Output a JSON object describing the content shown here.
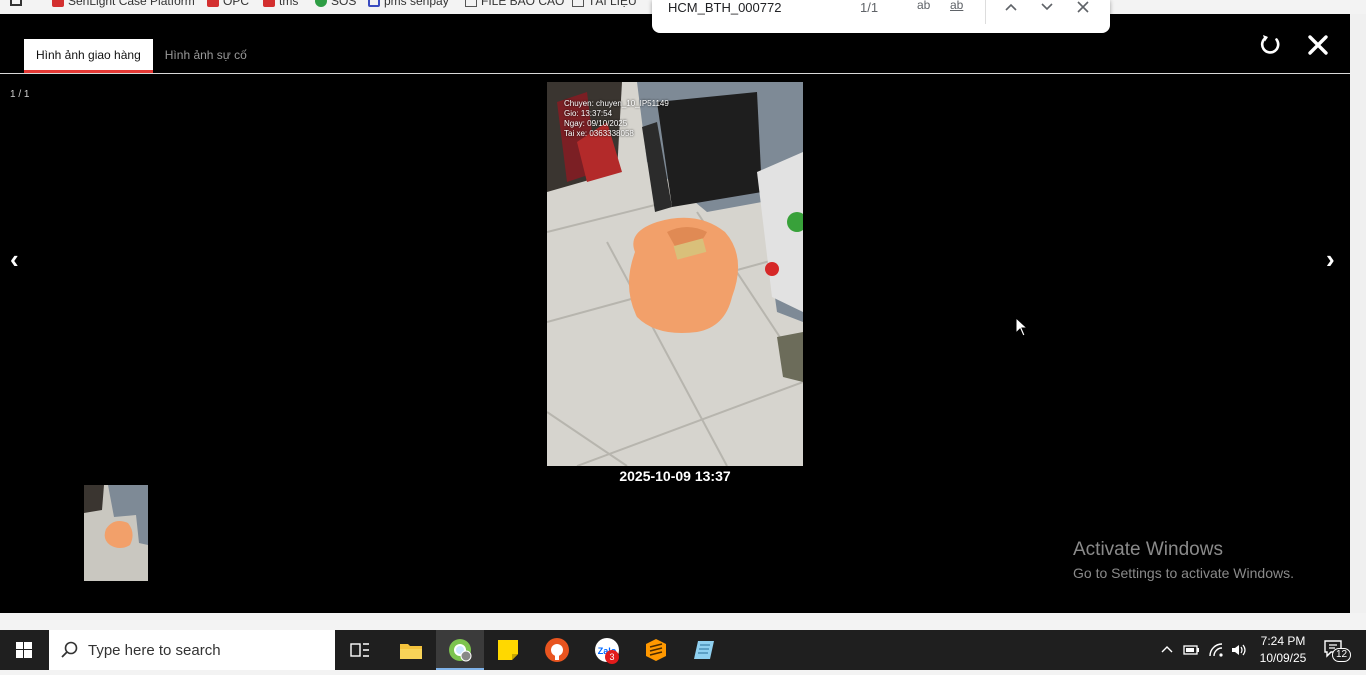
{
  "bookmarks": [
    {
      "label": "SenLight Case Platform",
      "icon": "red-bookmark-icon"
    },
    {
      "label": "OPC",
      "icon": "red-bookmark-icon"
    },
    {
      "label": "tms",
      "icon": "red-bookmark-icon"
    },
    {
      "label": "SOS",
      "icon": "green-bookmark-icon"
    },
    {
      "label": "pms senpay",
      "icon": "blue-bookmark-icon"
    },
    {
      "label": "FILE BÁO CÁO",
      "icon": "folder-icon"
    },
    {
      "label": "TÀI LIỆU",
      "icon": "folder-icon"
    }
  ],
  "find_bar": {
    "query": "HCM_BTH_000772",
    "count": "1/1",
    "match_case_label": "ab",
    "whole_word_label": "ab"
  },
  "viewer": {
    "tabs": [
      {
        "label": "Hình ảnh giao hàng",
        "active": true
      },
      {
        "label": "Hình ảnh sự cố",
        "active": false
      }
    ],
    "counter": "1 / 1",
    "prev_label": "‹",
    "next_label": "›",
    "photo": {
      "overlay_lines": [
        "Chuyen: chuyen_10_IP51149",
        "Gio: 13:37:54",
        "Ngay: 09/10/2025",
        "Tai xe: 0363338058"
      ],
      "caption": "2025-10-09 13:37"
    }
  },
  "watermark": {
    "title": "Activate Windows",
    "subtitle": "Go to Settings to activate Windows."
  },
  "taskbar": {
    "search_placeholder": "Type here to search",
    "zalo_badge": "3",
    "clock_time": "7:24 PM",
    "clock_date": "10/09/25",
    "notification_count": "12"
  },
  "colors": {
    "accent": "#e53935",
    "viewer_bg": "#000000",
    "taskbar_bg": "#1f1f1f"
  }
}
